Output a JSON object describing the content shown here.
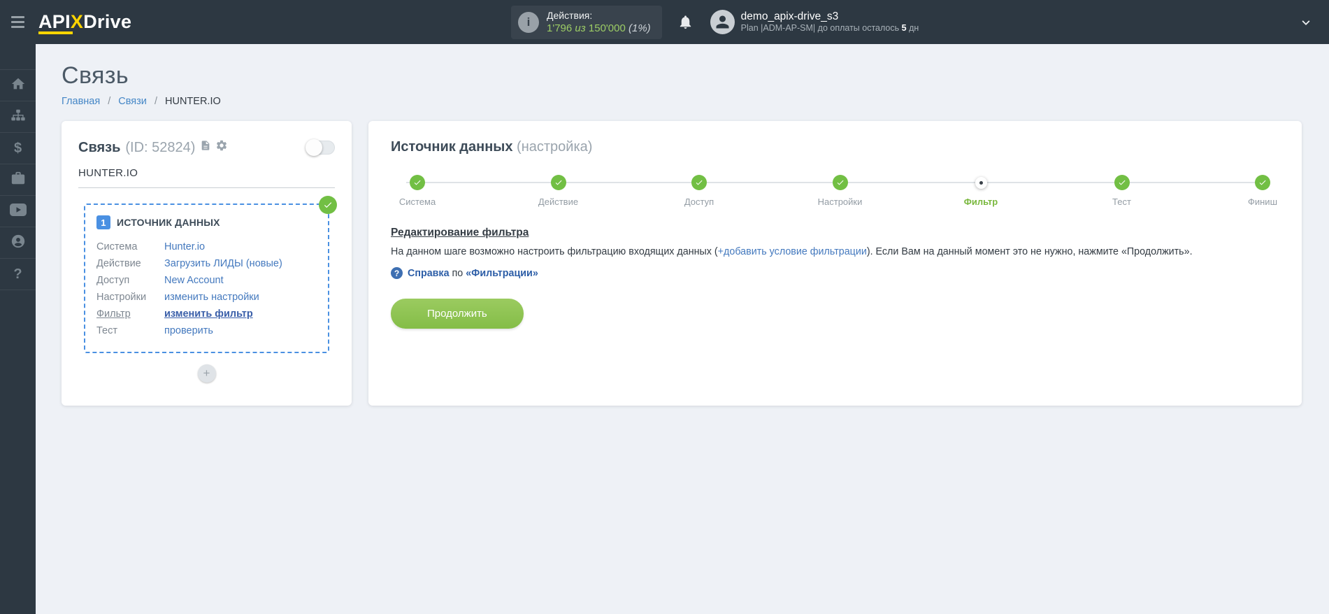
{
  "header": {
    "logo": {
      "api": "API",
      "x": "X",
      "drive": "Drive"
    },
    "actions": {
      "label": "Действия:",
      "used": "1'796",
      "of": "из",
      "total": "150'000",
      "percent": "(1%)"
    },
    "user": {
      "name": "demo_apix-drive_s3",
      "plan_prefix": "Plan |ADM-AP-SM| до оплаты осталось",
      "days": "5",
      "days_suffix": "дн"
    }
  },
  "page": {
    "title": "Связь",
    "breadcrumb": {
      "home": "Главная",
      "links": "Связи",
      "current": "HUNTER.IO",
      "separator": "/"
    }
  },
  "link_card": {
    "title": "Связь",
    "id_text": "(ID: 52824)",
    "name": "HUNTER.IO",
    "add_label": "+",
    "source_box": {
      "badge": "1",
      "title": "ИСТОЧНИК ДАННЫХ",
      "rows": [
        {
          "label": "Система",
          "value": "Hunter.io"
        },
        {
          "label": "Действие",
          "value": "Загрузить ЛИДЫ (новые)"
        },
        {
          "label": "Доступ",
          "value": "New Account"
        },
        {
          "label": "Настройки",
          "value": "изменить настройки"
        },
        {
          "label": "Фильтр",
          "value": "изменить фильтр"
        },
        {
          "label": "Тест",
          "value": "проверить"
        }
      ]
    }
  },
  "setup_card": {
    "title": "Источник данных",
    "title_suffix": "(настройка)",
    "steps": [
      {
        "label": "Система",
        "state": "done"
      },
      {
        "label": "Действие",
        "state": "done"
      },
      {
        "label": "Доступ",
        "state": "done"
      },
      {
        "label": "Настройки",
        "state": "done"
      },
      {
        "label": "Фильтр",
        "state": "current"
      },
      {
        "label": "Тест",
        "state": "done"
      },
      {
        "label": "Финиш",
        "state": "done"
      }
    ],
    "section_title": "Редактирование фильтра",
    "paragraph": {
      "part1": "На данном шаге возможно настроить фильтрацию входящих данных (",
      "link": "+добавить условие фильтрации",
      "part2": "). Если Вам на данный момент это не нужно, нажмите «Продолжить»."
    },
    "help": {
      "icon": "?",
      "bold1": "Справка",
      "mid": "по",
      "bold2": "«Фильтрации»"
    },
    "continue_button": "Продолжить"
  },
  "icons": {
    "info": "i",
    "dollar": "$",
    "question": "?"
  },
  "colors": {
    "header_bg": "#2d3842",
    "accent_yellow": "#ffd500",
    "accent_green": "#72bf44",
    "link_blue": "#4479be",
    "dashed_blue": "#4a90e2"
  }
}
